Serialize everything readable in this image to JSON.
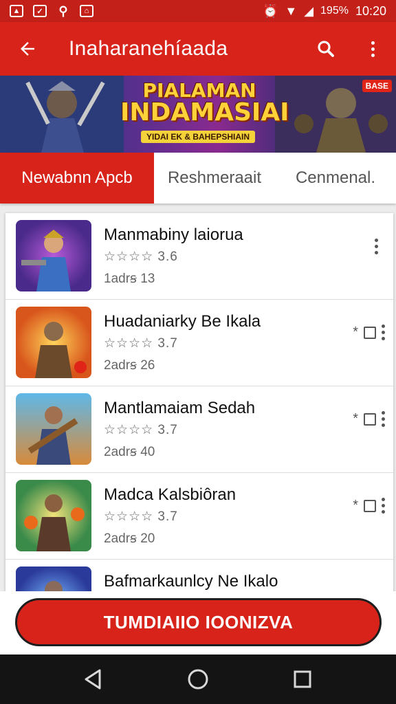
{
  "status": {
    "battery": "195%",
    "time": "10:20"
  },
  "appbar": {
    "title": "Inaharanehíaada"
  },
  "banner": {
    "title_line1": "PIALAMAN",
    "title_line2": "INDAMASIAI",
    "subtitle": "YIDAI EK & BAHEPSHIAIN",
    "badge": "BASE"
  },
  "tabs": [
    {
      "label": "Newabnn Apcb"
    },
    {
      "label": "Reshmeraait"
    },
    {
      "label": "Cenmenal."
    }
  ],
  "apps": [
    {
      "name": "Manmabiny laiorua",
      "rating": "☆☆☆☆ 3.6",
      "size": "1adrꞩ 13"
    },
    {
      "name": "Huadaniarky Be Ikala",
      "rating": "☆☆☆☆ 3.7",
      "size": "2adrꞩ 26"
    },
    {
      "name": "Mantlamaiam Sedah",
      "rating": "☆☆☆☆ 3.7",
      "size": "2adrꞩ 40"
    },
    {
      "name": "Madca Kalsbiôran",
      "rating": "☆☆☆☆ 3.7",
      "size": "2adrꞩ 20"
    },
    {
      "name": "Bafmarkaunlcy Ne Ikalo",
      "rating": "",
      "size": ""
    }
  ],
  "cta": {
    "label": "TUMDIAIIO IOONIZVA"
  },
  "colors": {
    "accent": "#d8231b",
    "nav": "#141414"
  }
}
